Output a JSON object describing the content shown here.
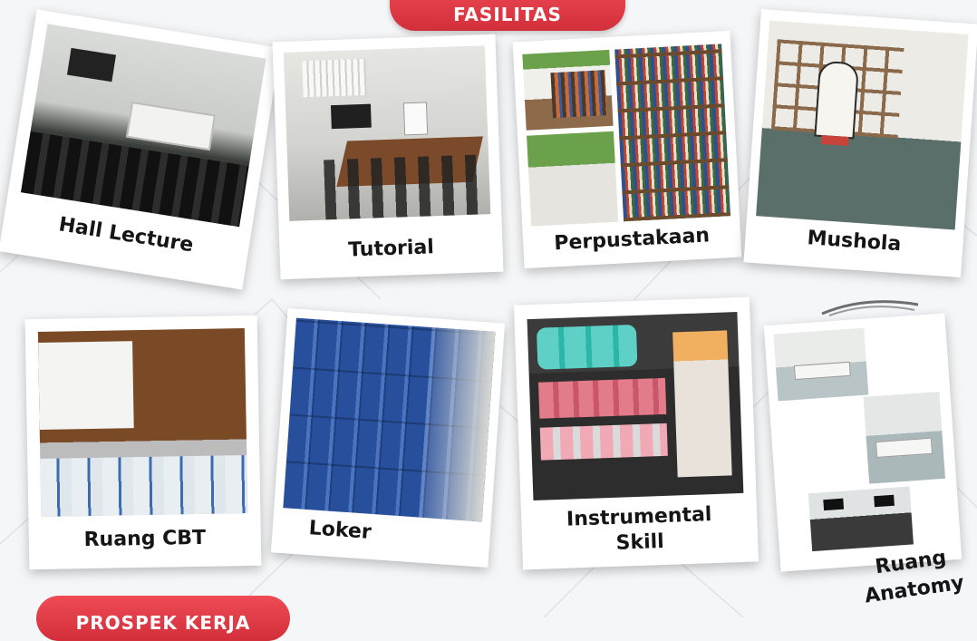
{
  "header": {
    "title": "FASILITAS"
  },
  "footer": {
    "title": "PROSPEK KERJA"
  },
  "cards": [
    {
      "label": "Hall Lecture"
    },
    {
      "label": "Tutorial"
    },
    {
      "label": "Perpustakaan"
    },
    {
      "label": "Mushola"
    },
    {
      "label": "Ruang CBT"
    },
    {
      "label": "Loker"
    },
    {
      "label_line1": "Instrumental",
      "label_line2": "Skill"
    },
    {
      "label_line1": "Ruang",
      "label_line2": "Anatomy"
    }
  ],
  "colors": {
    "accent": "#e23c48",
    "background": "#f4f6f8"
  }
}
